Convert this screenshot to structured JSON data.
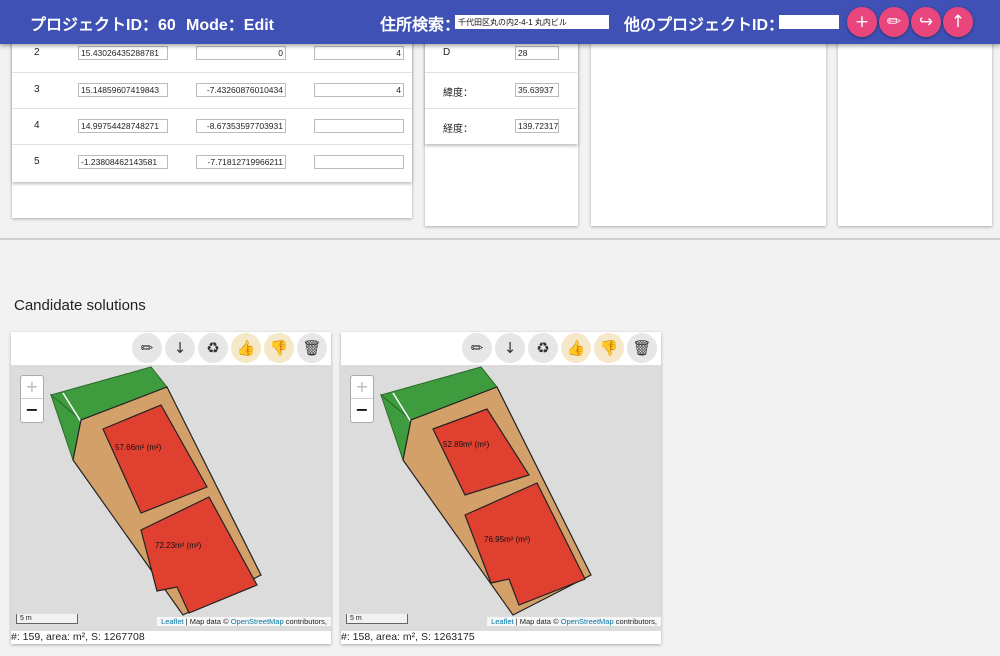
{
  "header": {
    "project_id": "プロジェクトID：60",
    "mode": "Mode：Edit",
    "address_label": "住所検索：",
    "address_value": "千代田区丸の内2-4-1 丸内ビル",
    "other_project_label": "他のプロジェクトID：",
    "other_project_value": "",
    "actions": [
      {
        "name": "add",
        "icon": "plus-icon",
        "glyph": "+"
      },
      {
        "name": "edit",
        "icon": "pencil-icon",
        "glyph": "✏"
      },
      {
        "name": "redirect",
        "icon": "redirect-arrow-icon",
        "glyph": "↪"
      },
      {
        "name": "upload",
        "icon": "arrow-up-icon",
        "glyph": "↑"
      }
    ]
  },
  "points_table": {
    "rows": [
      {
        "no": "2",
        "x": "15.43026435288781",
        "y": "0",
        "z": "4"
      },
      {
        "no": "3",
        "x": "15.14859607419843",
        "y": "-7.43260876010434",
        "z": "4"
      },
      {
        "no": "4",
        "x": "14.99754428748271",
        "y": "-8.67353597703931",
        "z": ""
      },
      {
        "no": "5",
        "x": "-1.23808462143581",
        "y": "-7.71812719966211",
        "z": ""
      }
    ]
  },
  "params_panel": {
    "rows": [
      {
        "label": "D",
        "value": "28"
      },
      {
        "label": "緯度：",
        "value": "35.63937"
      },
      {
        "label": "経度：",
        "value": "139.72317"
      }
    ]
  },
  "candidates": {
    "title": "Candidate solutions",
    "toolbar_icons": [
      {
        "icon": "pencil-icon",
        "glyph": "✏"
      },
      {
        "icon": "download-icon",
        "glyph": "↓"
      },
      {
        "icon": "recycle-icon",
        "glyph": "♻"
      },
      {
        "icon": "thumbs-up-icon",
        "glyph": "👍"
      },
      {
        "icon": "thumbs-down-icon",
        "glyph": "👎"
      },
      {
        "icon": "trash-icon",
        "glyph": "🗑"
      }
    ],
    "zoom_in": "+",
    "zoom_out": "−",
    "scale_label": "5 m",
    "attribution": {
      "leaflet": "Leaflet",
      "sep": " | Map data © ",
      "osm": "OpenStreetMap",
      "tail": " contributors,"
    },
    "items": [
      {
        "area_a": "57.66m² (m²)",
        "area_b": "72.23m² (m²)",
        "footer": "#: 159, area: m², S: 1267708"
      },
      {
        "area_a": "52.89m² (m²)",
        "area_b": "76.95m² (m²)",
        "footer": "#: 158, area: m², S: 1263175"
      }
    ]
  },
  "colors": {
    "header": "#3f51b5",
    "fab": "#e8467c",
    "road": "#3e9b3e",
    "site": "#d4a06a",
    "building": "#e04030"
  }
}
